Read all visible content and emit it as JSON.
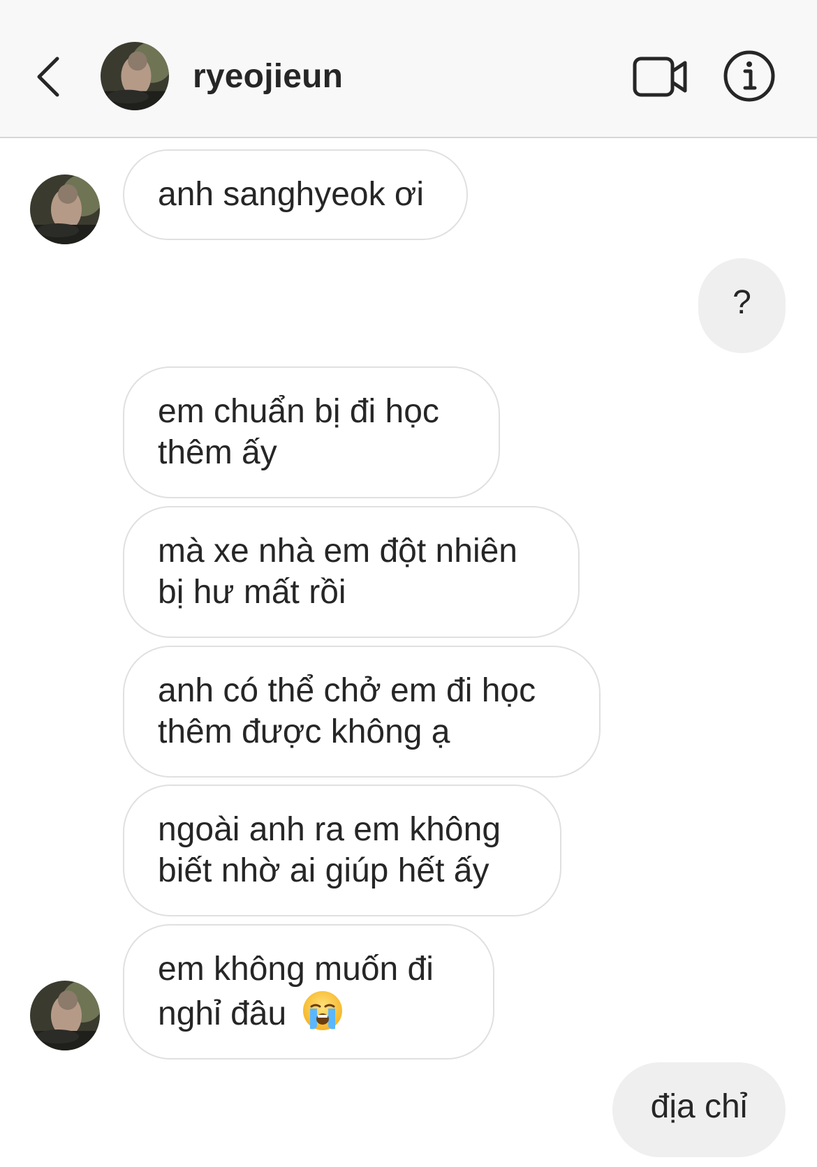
{
  "header": {
    "username": "ryeojieun",
    "icons": {
      "back": "chevron-left-icon",
      "video": "video-camera-icon",
      "info": "info-circle-icon"
    }
  },
  "messages": [
    {
      "from": "them",
      "text": "anh sanghyeok ơi"
    },
    {
      "from": "me",
      "text": "?"
    },
    {
      "from": "them",
      "text": "em chuẩn bị đi học thêm ấy"
    },
    {
      "from": "them",
      "text": "mà xe nhà em đột nhiên bị hư mất rồi"
    },
    {
      "from": "them",
      "text": "anh có thể chở em đi học thêm được không ạ"
    },
    {
      "from": "them",
      "text": "ngoài anh ra em không biết nhờ ai giúp hết ấy"
    },
    {
      "from": "them",
      "text": "em không muốn đi nghỉ đâu",
      "emoji": "loudly-crying-face"
    },
    {
      "from": "me",
      "text": "địa chỉ"
    }
  ],
  "colors": {
    "header_bg": "#f8f8f8",
    "incoming_border": "#e0e0e0",
    "outgoing_bg": "#efefef",
    "text": "#262626"
  }
}
